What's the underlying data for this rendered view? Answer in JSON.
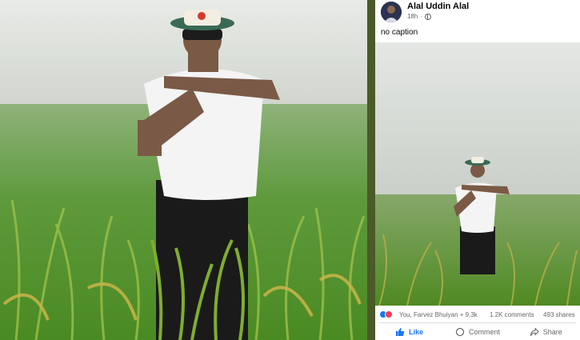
{
  "post": {
    "author": "Alal Uddin Alal",
    "time": "18h",
    "caption": "no caption",
    "reactions_text": "You, Farvez Bhuiyan + 9.3k",
    "comments": "1.2K comments",
    "shares": "493 shares",
    "actions": {
      "like": "Like",
      "comment": "Comment",
      "share": "Share"
    }
  },
  "colors": {
    "divider": "#4a5a28",
    "like_blue": "#1877f2",
    "love_red": "#f33e58"
  }
}
